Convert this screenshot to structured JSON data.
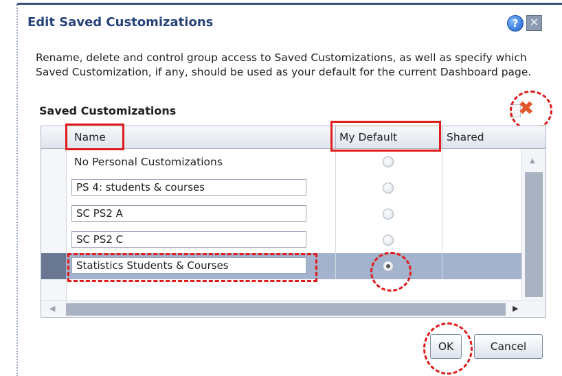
{
  "dialog": {
    "title": "Edit Saved Customizations",
    "help_icon": "question-mark-icon",
    "close_icon": "close-x-icon",
    "help_glyph": "?",
    "close_glyph": "✕"
  },
  "instructions": "Rename, delete and control group access to Saved Customizations, as well as specify which Saved Customization, if any, should be used as your default for the current Dashboard page.",
  "section": {
    "title": "Saved Customizations",
    "copy_icon": "copy-icon",
    "delete_icon": "delete-x-icon",
    "delete_glyph": "✖"
  },
  "grid": {
    "columns": {
      "name": "Name",
      "my_default": "My Default",
      "shared": "Shared"
    },
    "rows": [
      {
        "name": "No Personal Customizations",
        "editable": false,
        "default": false,
        "selected": false
      },
      {
        "name": "PS 4: students & courses",
        "editable": true,
        "default": false,
        "selected": false
      },
      {
        "name": "SC PS2 A",
        "editable": true,
        "default": false,
        "selected": false
      },
      {
        "name": "SC PS2 C",
        "editable": true,
        "default": false,
        "selected": false
      },
      {
        "name": "Statistics Students & Courses",
        "editable": true,
        "default": true,
        "selected": true
      }
    ]
  },
  "buttons": {
    "ok": "OK",
    "cancel": "Cancel"
  },
  "colors": {
    "title": "#27427a",
    "selected_row": "#a4b3cd",
    "annotation": "#e01b1b"
  }
}
